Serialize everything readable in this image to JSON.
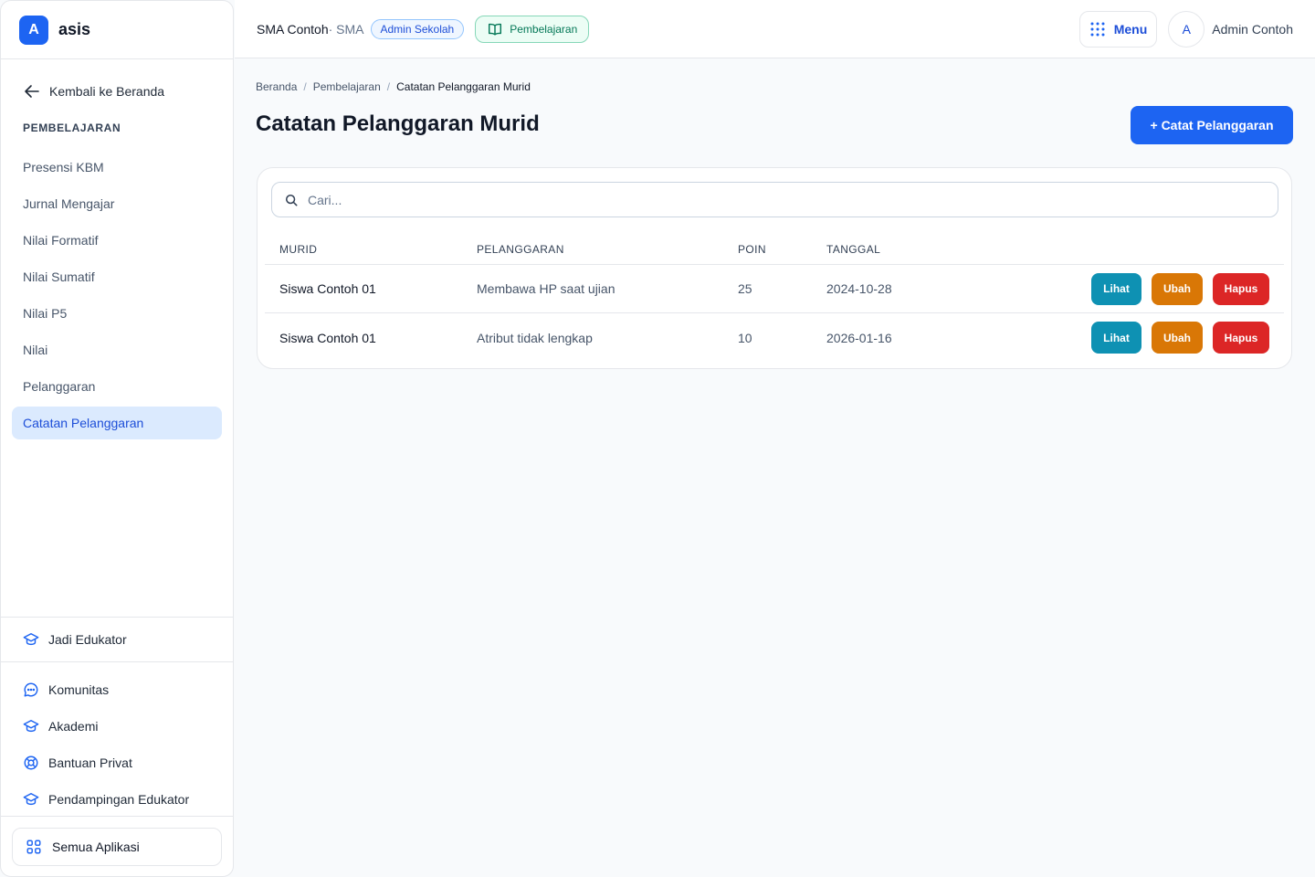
{
  "brand": {
    "logo_letter": "A",
    "name": "asis",
    "color": "#1d64f2"
  },
  "sidebar": {
    "back_label": "Kembali ke Beranda",
    "section_title": "PEMBELAJARAN",
    "items": [
      {
        "label": "Presensi KBM"
      },
      {
        "label": "Jurnal Mengajar"
      },
      {
        "label": "Nilai Formatif"
      },
      {
        "label": "Nilai Sumatif"
      },
      {
        "label": "Nilai P5"
      },
      {
        "label": "Nilai"
      },
      {
        "label": "Pelanggaran"
      },
      {
        "label": "Catatan Pelanggaran",
        "active": true
      }
    ],
    "edukator_label": "Jadi Edukator",
    "extras": [
      {
        "label": "Komunitas",
        "icon": "chat-icon"
      },
      {
        "label": "Akademi",
        "icon": "graduation-cap-icon"
      },
      {
        "label": "Bantuan Privat",
        "icon": "lifebuoy-icon"
      },
      {
        "label": "Pendampingan Edukator",
        "icon": "graduation-cap-icon"
      }
    ],
    "all_apps_label": "Semua Aplikasi"
  },
  "header": {
    "school_name": "SMA Contoh",
    "school_type": " · SMA",
    "role_badge": "Admin Sekolah",
    "module_badge": "Pembelajaran",
    "menu_label": "Menu",
    "avatar_letter": "A",
    "user_name": "Admin Contoh"
  },
  "breadcrumb": {
    "items": [
      "Beranda",
      "Pembelajaran"
    ],
    "current": "Catatan Pelanggaran Murid",
    "separator": "/"
  },
  "page": {
    "title": "Catatan Pelanggaran Murid",
    "add_button": "+ Catat Pelanggaran"
  },
  "search": {
    "placeholder": "Cari..."
  },
  "table": {
    "headers": [
      "MURID",
      "PELANGGARAN",
      "POIN",
      "TANGGAL"
    ],
    "rows": [
      {
        "murid": "Siswa Contoh 01",
        "pelanggaran": "Membawa HP saat ujian",
        "poin": "25",
        "tanggal": "2024-10-28"
      },
      {
        "murid": "Siswa Contoh 01",
        "pelanggaran": "Atribut tidak lengkap",
        "poin": "10",
        "tanggal": "2026-01-16"
      }
    ],
    "actions": {
      "view": "Lihat",
      "edit": "Ubah",
      "delete": "Hapus"
    },
    "action_colors": {
      "view": "#0e91b3",
      "edit": "#d97706",
      "delete": "#dc2626"
    }
  }
}
